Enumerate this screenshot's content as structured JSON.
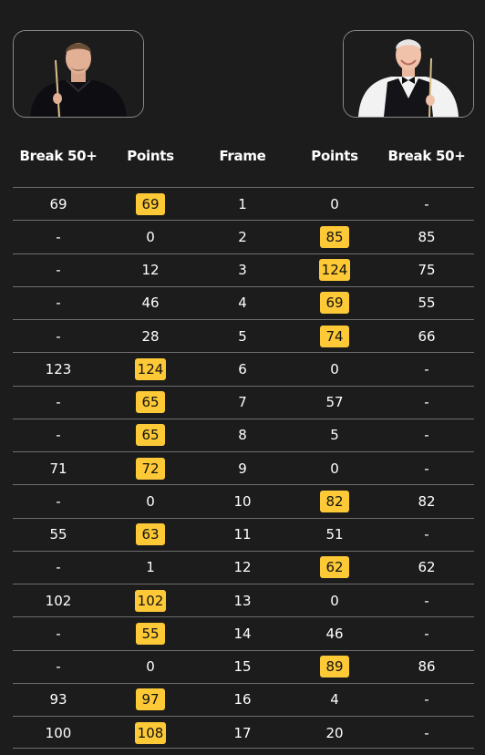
{
  "players": {
    "left": {
      "image": "player-photo-dark-shirt"
    },
    "right": {
      "image": "player-photo-waistcoat"
    }
  },
  "headers": [
    "Break 50+",
    "Points",
    "Frame",
    "Points",
    "Break 50+"
  ],
  "colors": {
    "badge": "#fdc937",
    "background": "#1c1c1c",
    "divider": "#6e6e6e"
  },
  "frames": [
    {
      "frame": "1",
      "left_break": "69",
      "left_points": "69",
      "right_points": "0",
      "right_break": "-",
      "winner": "left"
    },
    {
      "frame": "2",
      "left_break": "-",
      "left_points": "0",
      "right_points": "85",
      "right_break": "85",
      "winner": "right"
    },
    {
      "frame": "3",
      "left_break": "-",
      "left_points": "12",
      "right_points": "124",
      "right_break": "75",
      "winner": "right"
    },
    {
      "frame": "4",
      "left_break": "-",
      "left_points": "46",
      "right_points": "69",
      "right_break": "55",
      "winner": "right"
    },
    {
      "frame": "5",
      "left_break": "-",
      "left_points": "28",
      "right_points": "74",
      "right_break": "66",
      "winner": "right"
    },
    {
      "frame": "6",
      "left_break": "123",
      "left_points": "124",
      "right_points": "0",
      "right_break": "-",
      "winner": "left"
    },
    {
      "frame": "7",
      "left_break": "-",
      "left_points": "65",
      "right_points": "57",
      "right_break": "-",
      "winner": "left"
    },
    {
      "frame": "8",
      "left_break": "-",
      "left_points": "65",
      "right_points": "5",
      "right_break": "-",
      "winner": "left"
    },
    {
      "frame": "9",
      "left_break": "71",
      "left_points": "72",
      "right_points": "0",
      "right_break": "-",
      "winner": "left"
    },
    {
      "frame": "10",
      "left_break": "-",
      "left_points": "0",
      "right_points": "82",
      "right_break": "82",
      "winner": "right"
    },
    {
      "frame": "11",
      "left_break": "55",
      "left_points": "63",
      "right_points": "51",
      "right_break": "-",
      "winner": "left"
    },
    {
      "frame": "12",
      "left_break": "-",
      "left_points": "1",
      "right_points": "62",
      "right_break": "62",
      "winner": "right"
    },
    {
      "frame": "13",
      "left_break": "102",
      "left_points": "102",
      "right_points": "0",
      "right_break": "-",
      "winner": "left"
    },
    {
      "frame": "14",
      "left_break": "-",
      "left_points": "55",
      "right_points": "46",
      "right_break": "-",
      "winner": "left"
    },
    {
      "frame": "15",
      "left_break": "-",
      "left_points": "0",
      "right_points": "89",
      "right_break": "86",
      "winner": "right"
    },
    {
      "frame": "16",
      "left_break": "93",
      "left_points": "97",
      "right_points": "4",
      "right_break": "-",
      "winner": "left"
    },
    {
      "frame": "17",
      "left_break": "100",
      "left_points": "108",
      "right_points": "20",
      "right_break": "-",
      "winner": "left"
    }
  ]
}
